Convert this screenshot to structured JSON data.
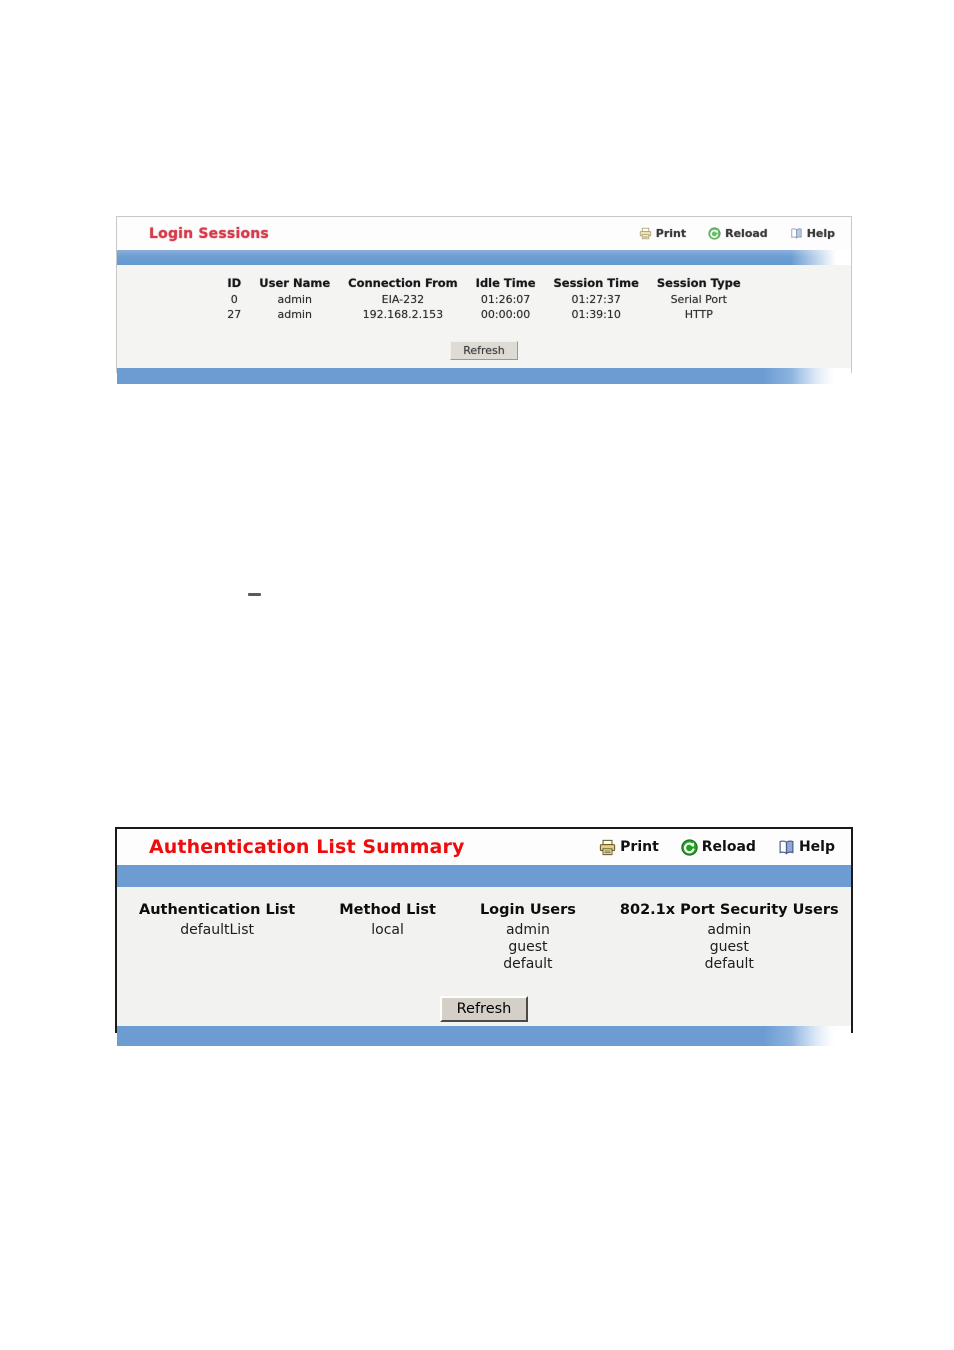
{
  "page": {
    "background": "#ffffff",
    "accent_blue": "#6d9cd2",
    "title_red_soft": "#d9394a",
    "title_red_crisp": "#ef0c0c"
  },
  "artifact": {
    "name": "stray-dash-mark"
  },
  "panels": [
    {
      "id": "login-sessions",
      "title": "Login Sessions",
      "toolbar": [
        {
          "label": "Print",
          "icon": "printer-icon"
        },
        {
          "label": "Reload",
          "icon": "reload-icon"
        },
        {
          "label": "Help",
          "icon": "help-book-icon"
        }
      ],
      "table": {
        "headers": [
          "ID",
          "User Name",
          "Connection From",
          "Idle Time",
          "Session Time",
          "Session Type"
        ],
        "rows": [
          [
            "0",
            "admin",
            "EIA-232",
            "01:26:07",
            "01:27:37",
            "Serial Port"
          ],
          [
            "27",
            "admin",
            "192.168.2.153",
            "00:00:00",
            "01:39:10",
            "HTTP"
          ]
        ]
      },
      "refresh_label": "Refresh"
    },
    {
      "id": "authentication-list-summary",
      "title": "Authentication List Summary",
      "toolbar": [
        {
          "label": "Print",
          "icon": "printer-icon"
        },
        {
          "label": "Reload",
          "icon": "reload-icon"
        },
        {
          "label": "Help",
          "icon": "help-book-icon"
        }
      ],
      "table": {
        "headers": [
          "Authentication List",
          "Method List",
          "Login Users",
          "802.1x Port Security Users"
        ],
        "rows": [
          {
            "authentication_list": "defaultList",
            "method_list": "local",
            "login_users": [
              "admin",
              "guest",
              "default"
            ],
            "port_security_users": [
              "admin",
              "guest",
              "default"
            ]
          }
        ]
      },
      "refresh_label": "Refresh"
    }
  ]
}
